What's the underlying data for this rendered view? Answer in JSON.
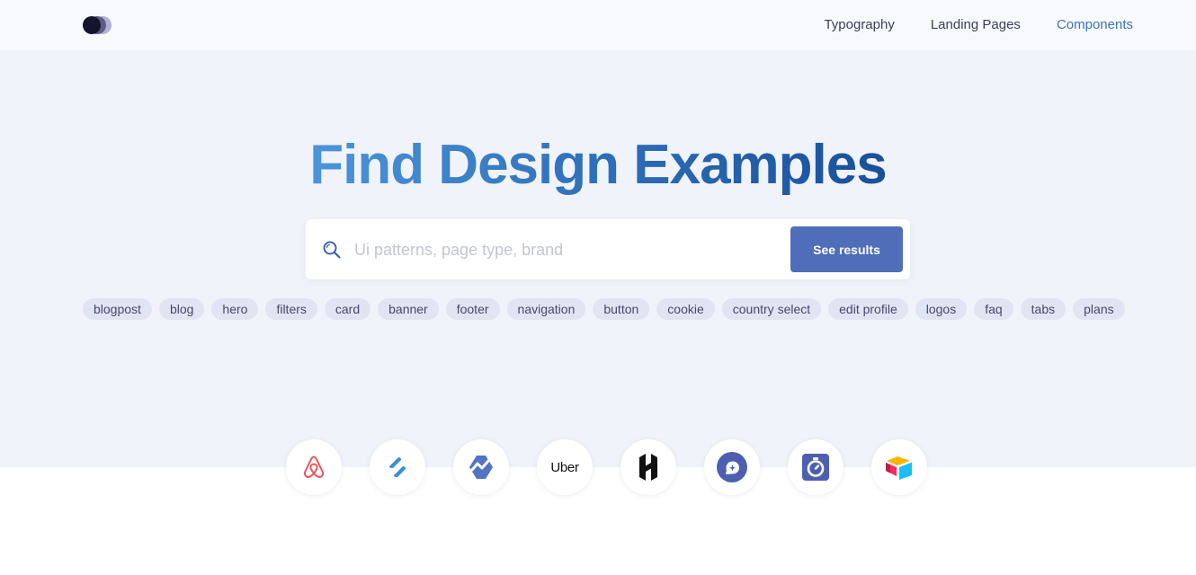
{
  "nav": {
    "items": [
      {
        "label": "Typography",
        "active": false
      },
      {
        "label": "Landing Pages",
        "active": false
      },
      {
        "label": "Components",
        "active": true
      }
    ]
  },
  "hero": {
    "title": "Find Design Examples",
    "search": {
      "placeholder": "Ui patterns, page type, brand",
      "value": "",
      "button_label": "See results"
    },
    "tags": [
      "blogpost",
      "blog",
      "hero",
      "filters",
      "card",
      "banner",
      "footer",
      "navigation",
      "button",
      "cookie",
      "country select",
      "edit profile",
      "logos",
      "faq",
      "tabs",
      "plans"
    ]
  },
  "brands": [
    {
      "icon": "airbnb-logo-icon"
    },
    {
      "icon": "helpscout-logo-icon"
    },
    {
      "icon": "baremetrics-logo-icon"
    },
    {
      "icon": "uber-logo-icon",
      "text": "Uber"
    },
    {
      "icon": "hashicorp-logo-icon"
    },
    {
      "icon": "chat-bubble-logo-icon"
    },
    {
      "icon": "stopwatch-logo-icon"
    },
    {
      "icon": "airtable-logo-icon"
    }
  ],
  "colors": {
    "accent": "#3b74b6",
    "button": "#4f6db8",
    "tag_bg": "#e1e4f3",
    "hero_bg": "#f1f3fa"
  }
}
